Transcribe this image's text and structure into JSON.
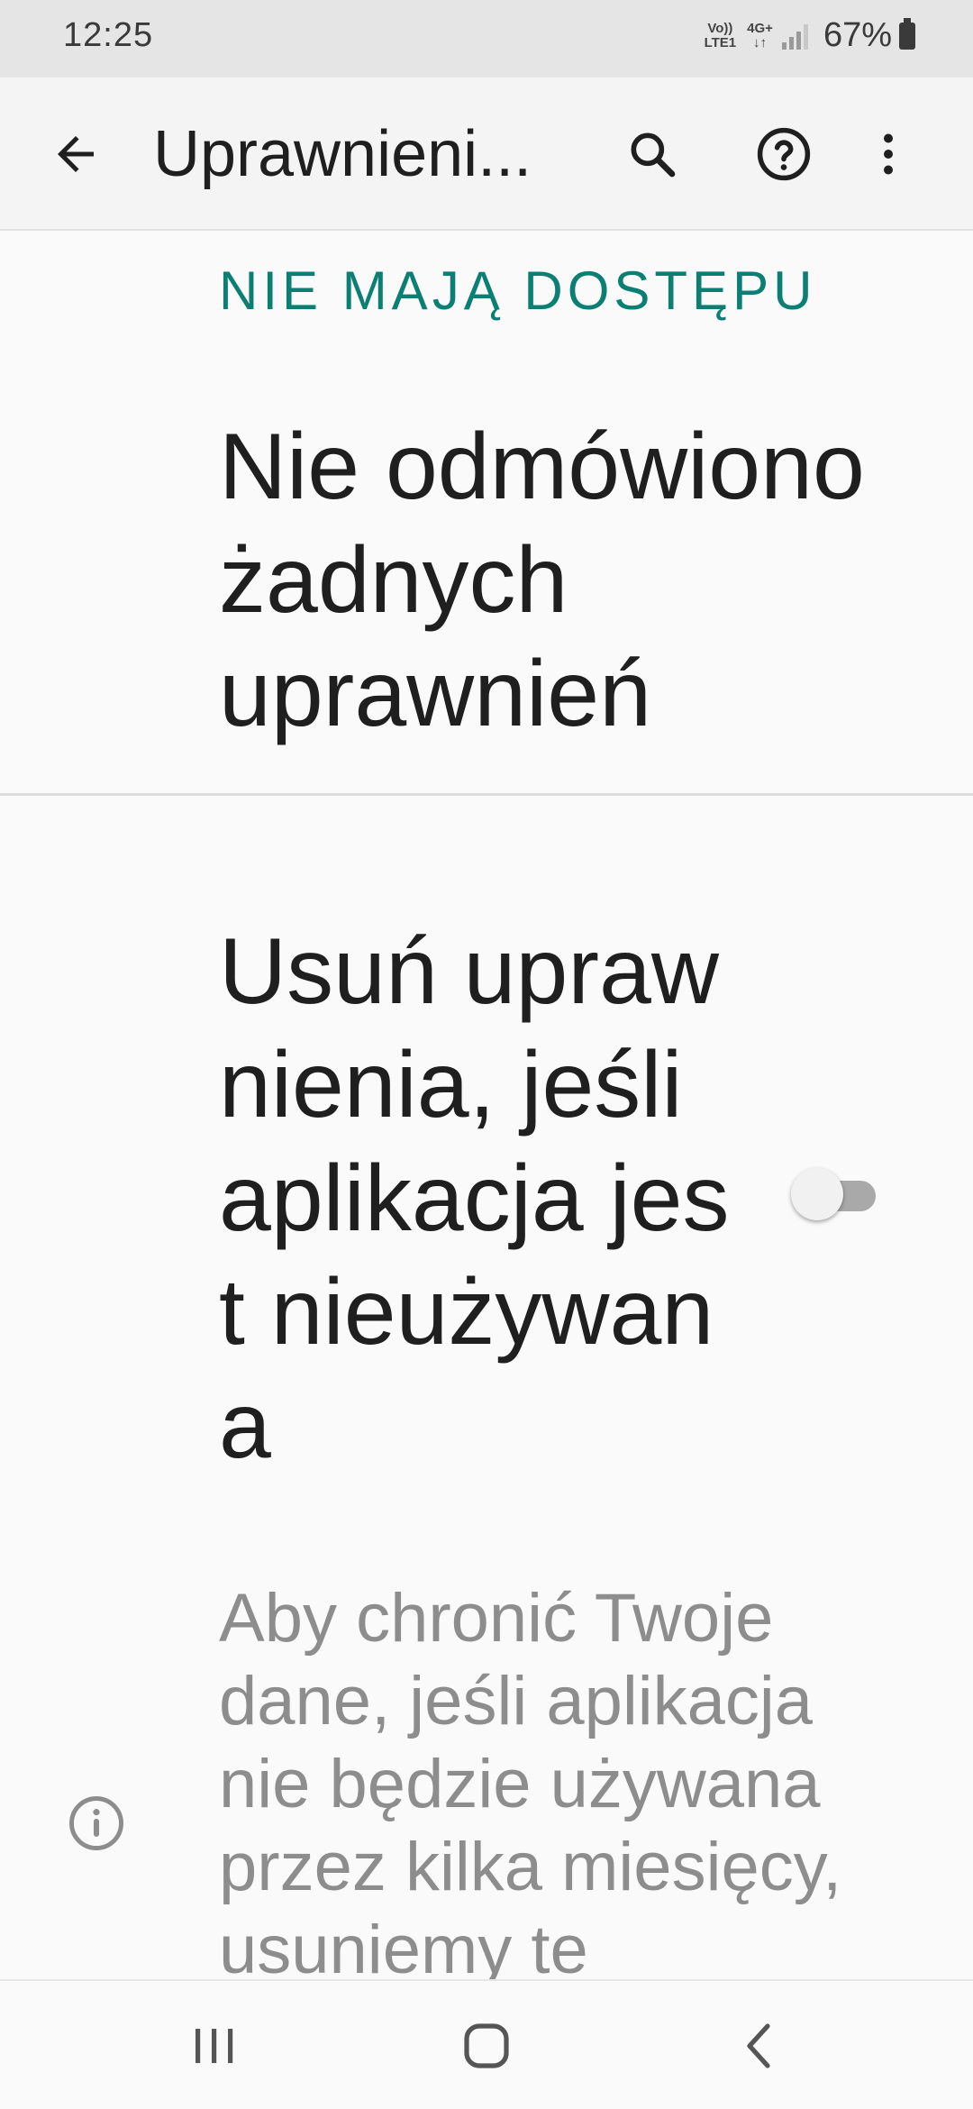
{
  "status_bar": {
    "time": "12:25",
    "volte_line1": "Vo))",
    "volte_line2": "LTE1",
    "network_type": "4G+",
    "battery": "67%"
  },
  "app_bar": {
    "title": "Uprawnieni..."
  },
  "section": {
    "header": "NIE MAJĄ DOSTĘPU",
    "empty_message": "Nie odmówiono żadnych uprawnień"
  },
  "auto_revoke": {
    "title": "Usuń upraw nienia, jeśli aplikacja jest nieużywana",
    "enabled": false,
    "info_text": "Aby chronić Twoje dane, jeśli aplikacja nie będzie używana przez kilka miesięcy, usuniemy te"
  },
  "icons": {
    "back": "arrow-back-icon",
    "search": "search-icon",
    "help": "help-icon",
    "more": "more-vert-icon",
    "info": "info-icon",
    "nav_recents": "recents-icon",
    "nav_home": "home-icon",
    "nav_back": "nav-back-icon"
  },
  "colors": {
    "accent": "#0b7f73",
    "status_bar_bg": "#e5e5e5",
    "background": "#fafafa"
  }
}
